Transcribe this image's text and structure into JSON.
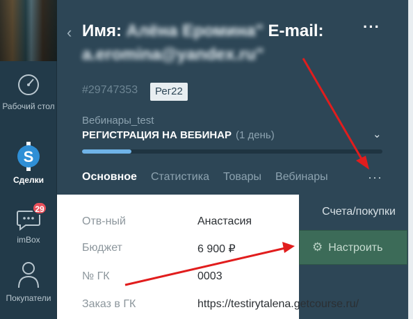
{
  "nav": {
    "items": [
      {
        "label": "Рабочий стол",
        "icon": "dashboard-icon"
      },
      {
        "label": "Сделки",
        "icon": "deals-icon"
      },
      {
        "label": "imBox",
        "icon": "chat-icon",
        "badge": "29"
      },
      {
        "label": "Покупатели",
        "icon": "customers-icon"
      }
    ]
  },
  "header": {
    "title_prefix": "Имя:",
    "title_name": "Алёна Еромина\"",
    "title_email_label": "E-mail:",
    "title_email": "a.eromina@yandex.ru\"",
    "deal_id": "#29747353",
    "tag": "Рег22",
    "funnel_name": "Вебинары_test",
    "stage": "РЕГИСТРАЦИЯ НА ВЕБИНАР",
    "stage_duration": "(1 день)",
    "stage_progress": 0.165,
    "more": "···"
  },
  "tabs": [
    {
      "label": "Основное",
      "active": true
    },
    {
      "label": "Статистика",
      "active": false
    },
    {
      "label": "Товары",
      "active": false
    },
    {
      "label": "Вебинары",
      "active": false
    }
  ],
  "tabs_more": "···",
  "side": {
    "payments_label": "Счета/покупки",
    "setup_label": "Настроить"
  },
  "fields": [
    {
      "label": "Отв-ный",
      "value": "Анастасия"
    },
    {
      "label": "Бюджет",
      "value": "6 900  ₽"
    },
    {
      "label": "№ ГК",
      "value": "0003"
    },
    {
      "label": "Заказ в ГК",
      "value": "https://testirytalena.getcourse.ru/"
    }
  ],
  "colors": {
    "nav_bg": "#223a49",
    "header_bg": "#2d4656",
    "accent_blue": "#6fb3e8",
    "setup_green": "#3c6b58",
    "badge_red": "#e8505b",
    "arrow_red": "#e11d1d"
  }
}
